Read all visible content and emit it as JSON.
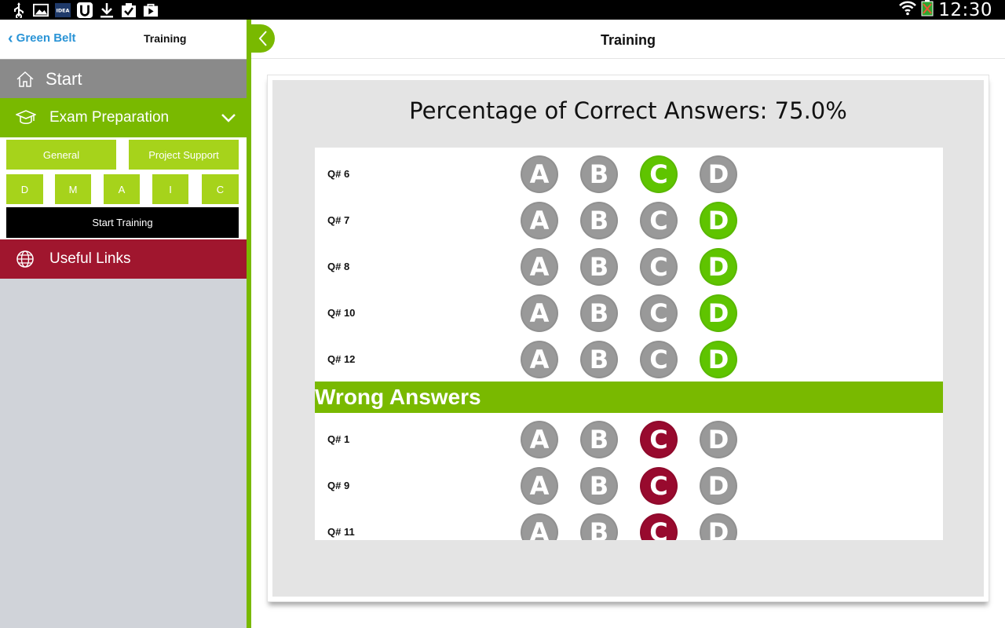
{
  "status_bar": {
    "left_icons": [
      "usb-icon",
      "image-icon",
      "idea-app-icon",
      "u-app-icon",
      "download-icon",
      "clipboard-check-icon",
      "play-store-icon"
    ],
    "right_icons": [
      "wifi-icon",
      "battery-icon"
    ],
    "time": "12:30"
  },
  "sidebar": {
    "back_label": "Green Belt",
    "title": "Training",
    "items": [
      {
        "label": "Start",
        "icon": "home-icon"
      },
      {
        "label": "Exam Preparation",
        "icon": "graduation-cap-icon"
      },
      {
        "label": "Useful Links",
        "icon": "globe-icon"
      }
    ],
    "submenu": {
      "categories": [
        "General",
        "Project Support"
      ],
      "phases": [
        "D",
        "M",
        "A",
        "I",
        "C"
      ],
      "start_label": "Start Training"
    }
  },
  "main": {
    "title": "Training",
    "percentage_label": "Percentage of Correct Answers:  75.0%",
    "options": [
      "A",
      "B",
      "C",
      "D"
    ],
    "correct_answers": [
      {
        "q": "Q# 6",
        "selected": "C"
      },
      {
        "q": "Q# 7",
        "selected": "D"
      },
      {
        "q": "Q# 8",
        "selected": "D"
      },
      {
        "q": "Q# 10",
        "selected": "D"
      },
      {
        "q": "Q# 12",
        "selected": "D"
      }
    ],
    "wrong_section_label": "Wrong Answers",
    "wrong_answers": [
      {
        "q": "Q# 1",
        "selected": "C"
      },
      {
        "q": "Q# 9",
        "selected": "C"
      },
      {
        "q": "Q# 11",
        "selected": "C"
      }
    ]
  },
  "colors": {
    "accent_green": "#79b900",
    "correct": "#5fc400",
    "wrong": "#980a2e",
    "neutral_option": "#999999",
    "links_red": "#a0162e",
    "link_blue": "#2a94d6"
  }
}
